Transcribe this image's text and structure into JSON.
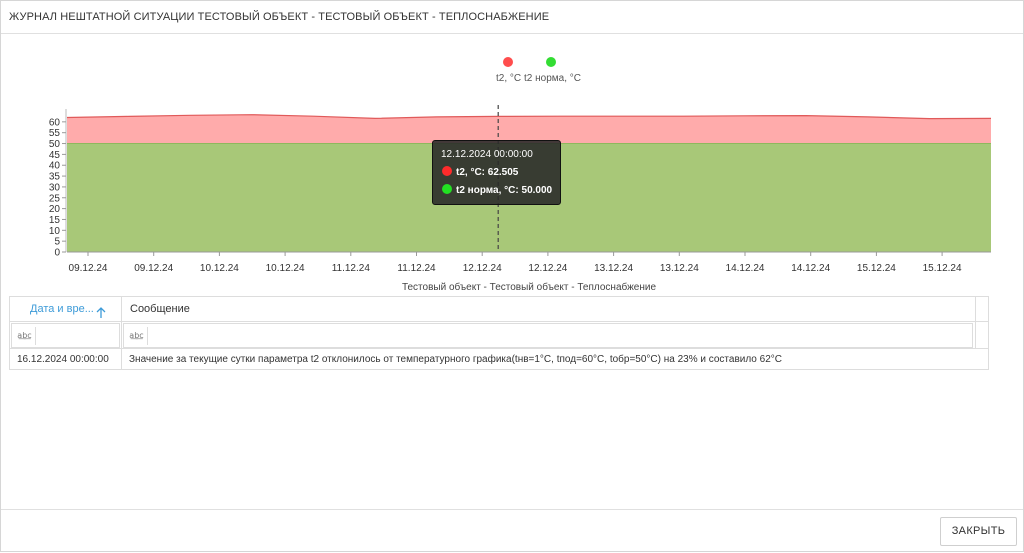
{
  "dialog": {
    "title": "ЖУРНАЛ НЕШТАТНОЙ СИТУАЦИИ ТЕСТОВЫЙ ОБЪЕКТ - ТЕСТОВЫЙ ОБЪЕКТ - ТЕПЛОСНАБЖЕНИЕ",
    "close_label": "ЗАКРЫТЬ"
  },
  "legend": {
    "t2_label": "t2, °C",
    "t2_norm_label": "t2 норма, °C"
  },
  "tooltip": {
    "date": "12.12.2024 00:00:00",
    "t2_line": "t2, °C: 62.505",
    "t2_norm_line": "t2 норма, °C: 50.000"
  },
  "chart_data": {
    "type": "area",
    "title": "",
    "xlabel": "Тестовый объект - Тестовый объект - Теплоснабжение",
    "ylabel": "",
    "ylim": [
      0,
      65
    ],
    "y_ticks": [
      0,
      5,
      10,
      15,
      20,
      25,
      30,
      35,
      40,
      45,
      50,
      55,
      60
    ],
    "x_ticks": [
      "09.12.24",
      "09.12.24",
      "10.12.24",
      "10.12.24",
      "11.12.24",
      "11.12.24",
      "12.12.24",
      "12.12.24",
      "13.12.24",
      "13.12.24",
      "14.12.24",
      "14.12.24",
      "15.12.24",
      "15.12.24"
    ],
    "x": [
      "08.12.2024 21:00",
      "09.12.2024 09:00",
      "09.12.2024 21:00",
      "10.12.2024 09:00",
      "10.12.2024 21:00",
      "11.12.2024 09:00",
      "11.12.2024 21:00",
      "12.12.2024 00:00",
      "12.12.2024 09:00",
      "12.12.2024 21:00",
      "13.12.2024 09:00",
      "13.12.2024 21:00",
      "14.12.2024 09:00",
      "14.12.2024 21:00",
      "15.12.2024 09:00",
      "15.12.2024 21:00"
    ],
    "series": [
      {
        "name": "t2, °C",
        "color": "#ff4d4d",
        "fill": "#ffabab",
        "values": [
          62.0,
          62.5,
          63.0,
          63.3,
          62.6,
          61.6,
          62.3,
          62.5,
          62.6,
          62.6,
          62.6,
          62.8,
          62.9,
          62.3,
          61.5,
          61.6
        ]
      },
      {
        "name": "t2 норма, °C",
        "color": "#33dd33",
        "fill": "#a8c878",
        "values": [
          50,
          50,
          50,
          50,
          50,
          50,
          50,
          50,
          50,
          50,
          50,
          50,
          50,
          50,
          50,
          50
        ]
      }
    ],
    "cursor_index": 7,
    "legend": "top-center",
    "grid": false
  },
  "grid": {
    "columns": [
      "Дата и вре...",
      "Сообщение"
    ],
    "sort_icon": "arrow-up-icon",
    "filter_icon": "text-filter-icon",
    "filter_icon_text": "a͟b͟c",
    "rows": [
      {
        "date": "16.12.2024 00:00:00",
        "message": "Значение за текущие сутки параметра t2 отклонилось от температурного графика(tнв=1°С, tпод=60°С, tобр=50°С) на 23% и составило 62°С"
      }
    ]
  },
  "colors": {
    "accent": "#3d9bd8",
    "t2": "#ff4d4d",
    "t2_norm": "#33dd33",
    "t2_fill": "#ffabab",
    "norm_fill": "#a8c878"
  }
}
